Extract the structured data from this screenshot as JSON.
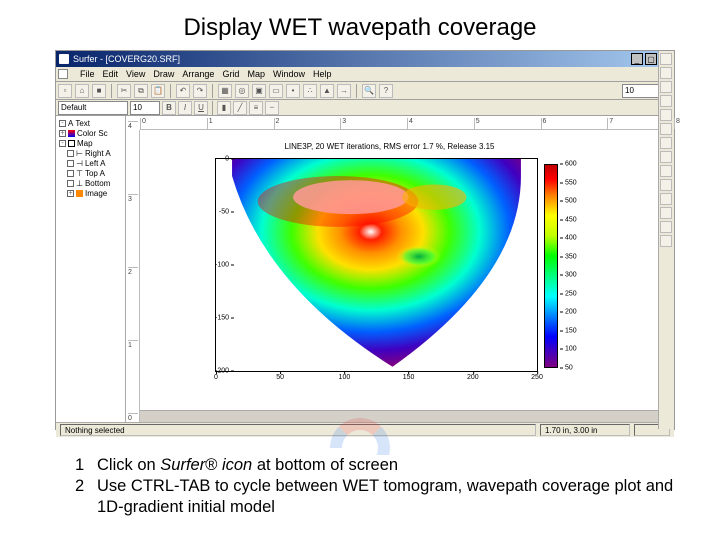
{
  "slide": {
    "title": "Display WET wavepath coverage"
  },
  "window": {
    "app": "Surfer",
    "docname": "[COVERG20.SRF]",
    "menu": [
      "File",
      "Edit",
      "View",
      "Draw",
      "Arrange",
      "Grid",
      "Map",
      "Window",
      "Help"
    ],
    "toolbar_hint_count": 18,
    "vtool_count": 14,
    "combos": [
      "10",
      "Default"
    ]
  },
  "tree": {
    "root": "Map",
    "items": [
      "Text",
      "Color Sc",
      "Right A",
      "Left A",
      "Top A",
      "Bottom",
      "Image"
    ]
  },
  "ruler": {
    "h": [
      "0",
      "1",
      "2",
      "3",
      "4",
      "5",
      "6",
      "7",
      "8"
    ],
    "v": [
      "0",
      "1",
      "2",
      "3",
      "4"
    ]
  },
  "chart_data": {
    "type": "heatmap",
    "title": "LINE3P,  20 WET iterations,  RMS error 1.7 %,  Release 3.15",
    "x_range": [
      0,
      250
    ],
    "x_ticks": [
      0,
      50,
      100,
      150,
      200,
      250
    ],
    "y_range": [
      -200,
      0
    ],
    "y_ticks": [
      0,
      -50,
      -100,
      -150,
      -200
    ],
    "color_range": [
      50,
      600
    ],
    "color_ticks": [
      600,
      550,
      500,
      450,
      400,
      350,
      300,
      250,
      200,
      150,
      100,
      50
    ],
    "quantity": "wavepath coverage",
    "unit": ""
  },
  "status": {
    "left": "Nothing selected",
    "right": "1.70 in, 3.00 in"
  },
  "instructions": [
    {
      "n": "1",
      "body": [
        {
          "t": "Click on ",
          "cls": ""
        },
        {
          "t": "Surfer",
          "cls": "it"
        },
        {
          "t": "® ",
          "cls": ""
        },
        {
          "t": "icon",
          "cls": "it"
        },
        {
          "t": " at bottom of screen",
          "cls": ""
        }
      ]
    },
    {
      "n": "2",
      "body": [
        {
          "t": "Use CTRL-TAB to cycle  between  WET tomogram, wavepath coverage plot and 1D-gradient initial model",
          "cls": ""
        }
      ]
    }
  ]
}
